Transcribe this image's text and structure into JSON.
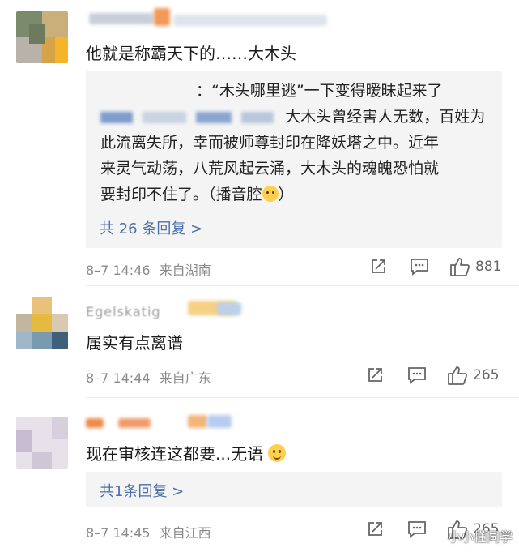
{
  "comments": [
    {
      "text": "他就是称霸天下的……大木头",
      "reply_preview": {
        "line1": "：“木头哪里逃”一下变得暧昧起来了",
        "line2_tail": "大木头曾经害人无数，百姓为",
        "line3": "此流离失所，幸而被师尊封印在降妖塔之中。近年",
        "line4": "来灵气动荡，八荒风起云涌，大木头的魂魄恐怕就",
        "line5": "要封印不住了。（播音腔",
        "line5_end": "）",
        "more": "共 26 条回复 >"
      },
      "time": "8–7 14:46",
      "source": "来自湖南",
      "likes": "881"
    },
    {
      "username": "Egelskatig",
      "text": "属实有点离谱",
      "time": "8–7 14:44",
      "source": "来自广东",
      "likes": "265"
    },
    {
      "text": "现在审核连这都要...无语",
      "reply_preview": {
        "more": "共1条回复 >"
      },
      "time": "8–7 14:45",
      "source": "来自江西",
      "likes": "265"
    }
  ],
  "watermark": "小小懂同学",
  "icons": {
    "share": "share-icon",
    "comment": "comment-icon",
    "like": "like-icon"
  },
  "colors": {
    "link": "#4d6fa8",
    "meta": "#8a8a8a",
    "reply_bg": "#f4f4f4"
  }
}
